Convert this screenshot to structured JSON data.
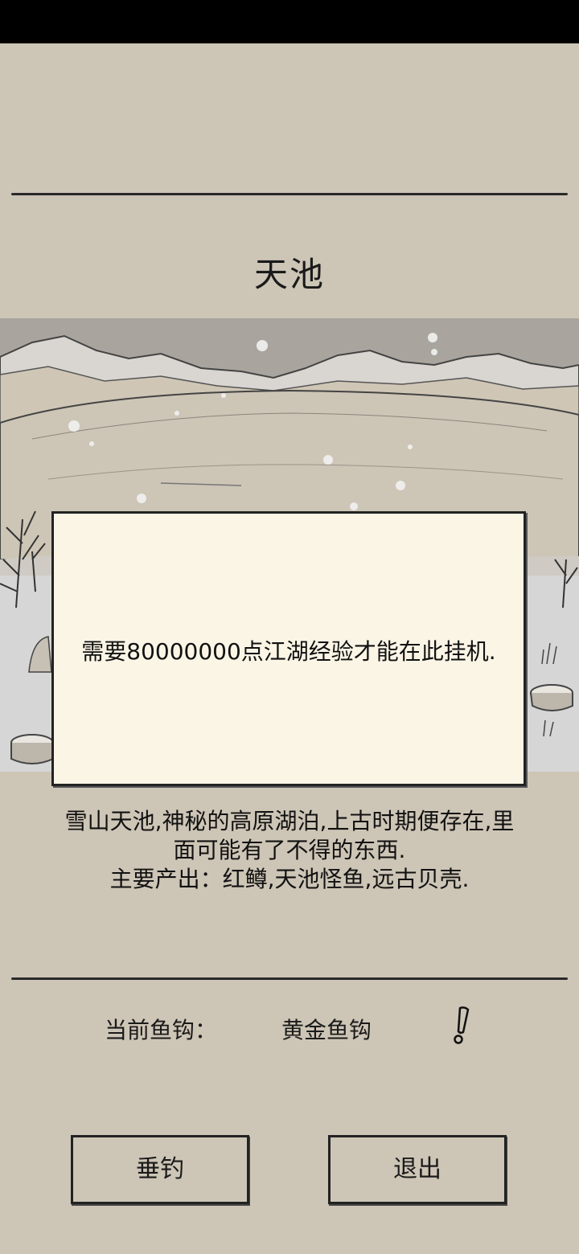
{
  "location": {
    "title": "天池"
  },
  "modal": {
    "message": "需要80000000点江湖经验才能在此挂机."
  },
  "description": {
    "lines": [
      "雪山天池,神秘的高原湖泊,上古时期便存在,里",
      "面可能有了不得的东西.",
      "主要产出：红鳟,天池怪鱼,远古贝壳."
    ]
  },
  "hook": {
    "label": "当前鱼钩：",
    "value": "黄金鱼钩",
    "info_icon": "exclamation-icon"
  },
  "buttons": {
    "fish": "垂钓",
    "quit": "退出"
  }
}
